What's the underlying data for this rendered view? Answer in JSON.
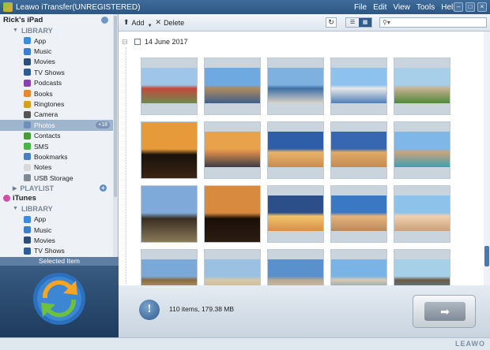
{
  "window": {
    "title": "Leawo iTransfer(UNREGISTERED)",
    "menu": [
      "File",
      "Edit",
      "View",
      "Tools",
      "Help"
    ],
    "controls": [
      "–",
      "□",
      "×"
    ]
  },
  "sidebar": {
    "device": "Rick's iPad",
    "library_label": "LIBRARY",
    "items": [
      {
        "label": "App",
        "icon": "app-icon",
        "color": "#3a8de0"
      },
      {
        "label": "Music",
        "icon": "music-icon",
        "color": "#3a7fd0"
      },
      {
        "label": "Movies",
        "icon": "movies-icon",
        "color": "#2c4e7a"
      },
      {
        "label": "TV Shows",
        "icon": "tv-shows-icon",
        "color": "#2d5d96"
      },
      {
        "label": "Podcasts",
        "icon": "podcasts-icon",
        "color": "#8a3fb0"
      },
      {
        "label": "Books",
        "icon": "books-icon",
        "color": "#e8882b"
      },
      {
        "label": "Ringtones",
        "icon": "ringtones-icon",
        "color": "#d8a021"
      },
      {
        "label": "Camera",
        "icon": "camera-icon",
        "color": "#555555"
      },
      {
        "label": "Photos",
        "icon": "photos-icon",
        "color": "#6e8fb8",
        "active": true,
        "badge": "+18"
      },
      {
        "label": "Contacts",
        "icon": "contacts-icon",
        "color": "#4b9b3a"
      },
      {
        "label": "SMS",
        "icon": "sms-icon",
        "color": "#48b548"
      },
      {
        "label": "Bookmarks",
        "icon": "bookmarks-icon",
        "color": "#4a7fc0"
      },
      {
        "label": "Notes",
        "icon": "notes-icon",
        "color": "#d9d9d9"
      },
      {
        "label": "USB Storage",
        "icon": "usb-storage-icon",
        "color": "#7f8a96"
      }
    ],
    "playlist_label": "PLAYLIST",
    "itunes_label": "iTunes",
    "itunes_library_label": "LIBRARY",
    "itunes_items": [
      {
        "label": "App",
        "icon": "app-icon",
        "color": "#3a8de0"
      },
      {
        "label": "Music",
        "icon": "music-icon",
        "color": "#3a7fd0"
      },
      {
        "label": "Movies",
        "icon": "movies-icon",
        "color": "#2c4e7a"
      },
      {
        "label": "TV Shows",
        "icon": "tv-shows-icon",
        "color": "#2d5d96"
      }
    ]
  },
  "selected_panel": {
    "title": "Selected Item"
  },
  "toolbar": {
    "add_label": "Add",
    "delete_label": "Delete",
    "refresh_glyph": "↻",
    "view_list_glyph": "☰",
    "view_grid_glyph": "▦",
    "search_placeholder": ""
  },
  "main": {
    "group_date": "14 June 2017",
    "photos": [
      {
        "type": "landscape",
        "sky": "#9fc6e8",
        "ground": "#6d8a4f",
        "accent": "#c44a3b"
      },
      {
        "type": "landscape",
        "sky": "#6fa9e2",
        "ground": "#3f5f8c",
        "accent": "#ad8a5e"
      },
      {
        "type": "landscape",
        "sky": "#7eb0e0",
        "ground": "#d9d3c5",
        "accent": "#3f6ea6"
      },
      {
        "type": "landscape",
        "sky": "#8dc2ee",
        "ground": "#4d7fb8",
        "accent": "#e8e8e8"
      },
      {
        "type": "landscape",
        "sky": "#a8cfe9",
        "ground": "#4e8a3a",
        "accent": "#c7b090"
      },
      {
        "type": "portrait",
        "sky": "#e69a3a",
        "ground": "#3a2414",
        "accent": "#1a120c"
      },
      {
        "type": "landscape",
        "sky": "#e9a24c",
        "ground": "#3a3c48",
        "accent": "#d58a4a"
      },
      {
        "type": "landscape",
        "sky": "#2e5ea8",
        "ground": "#c88a4e",
        "accent": "#e9b46a"
      },
      {
        "type": "landscape",
        "sky": "#3667b0",
        "ground": "#c58b53",
        "accent": "#e1aa66"
      },
      {
        "type": "landscape",
        "sky": "#7fb7e8",
        "ground": "#3f9fb0",
        "accent": "#c9a27a"
      },
      {
        "type": "portrait",
        "sky": "#7ea9d8",
        "ground": "#8a7a5a",
        "accent": "#3a2e22"
      },
      {
        "type": "portrait",
        "sky": "#d88a3e",
        "ground": "#2c1c12",
        "accent": "#1a0f08"
      },
      {
        "type": "landscape",
        "sky": "#2c4f8a",
        "ground": "#d68e4a",
        "accent": "#f2c46a"
      },
      {
        "type": "landscape",
        "sky": "#3a78c4",
        "ground": "#b88a5e",
        "accent": "#e6b37a"
      },
      {
        "type": "landscape",
        "sky": "#8dc3ea",
        "ground": "#c9a07a",
        "accent": "#f1d0b0"
      },
      {
        "type": "landscape",
        "sky": "#7aa9d8",
        "ground": "#cfc2a0",
        "accent": "#8a6a40"
      },
      {
        "type": "landscape",
        "sky": "#9ac0e2",
        "ground": "#bfae8a",
        "accent": "#d6c8a8"
      },
      {
        "type": "landscape",
        "sky": "#5a90cc",
        "ground": "#d9d2c4",
        "accent": "#b8a890"
      },
      {
        "type": "landscape",
        "sky": "#7ab4e6",
        "ground": "#3f7fb8",
        "accent": "#d9cab0"
      },
      {
        "type": "landscape",
        "sky": "#a6cfe8",
        "ground": "#4f9ec8",
        "accent": "#6b5a44"
      }
    ]
  },
  "status": {
    "info_glyph": "!",
    "summary": "110 items, 179.38 MB",
    "transfer_glyph": "➡"
  },
  "footer": {
    "brand": "LEAWO"
  }
}
